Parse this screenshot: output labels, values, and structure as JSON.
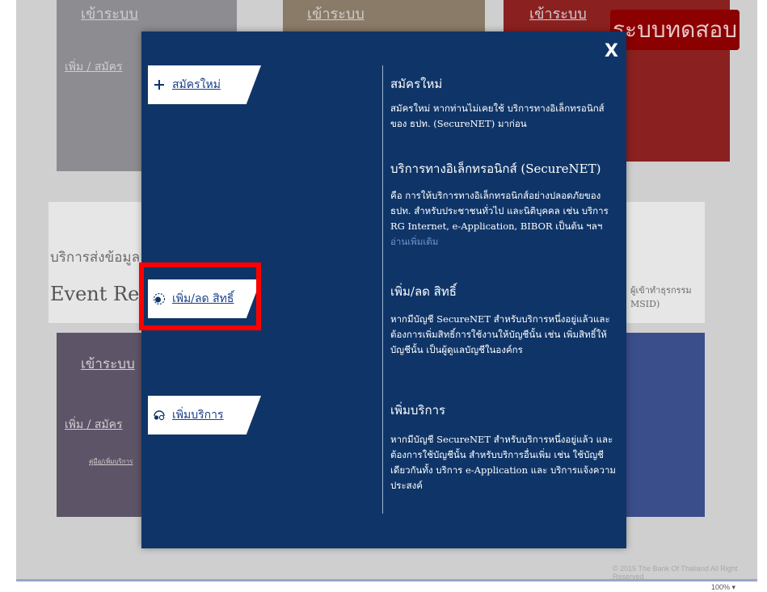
{
  "background": {
    "login_label_1": "เข้าระบบ",
    "login_label_2": "เข้าระบบ",
    "login_label_3": "เข้าระบบ",
    "test_badge": "ระบบทดสอบ",
    "add_apply_1": "เพิ่ม / สมัคร",
    "send_data_text": "บริการส่งข้อมูล",
    "event_text": "Event Re",
    "right_text_1": "ผู้เข้าทำธุรกรรม",
    "right_text_2": "MSID)",
    "login_label_4": "เข้าระบบ",
    "add_apply_2": "เพิ่ม / สมัคร",
    "small_link": "คู่มือ/เพิ่มบริการ",
    "copyright": "© 2015 The Bank Of Thailand All Right Reserved",
    "zoom": "100%"
  },
  "modal": {
    "close_label": "X",
    "options": {
      "register": "สมัครใหม่",
      "add_remove_rights": "เพิ่ม/ลด สิทธิ์",
      "add_service": "เพิ่มบริการ"
    },
    "sections": {
      "register_title": "สมัครใหม่",
      "register_desc": "สมัครใหม่ หากท่านไม่เคยใช้ บริการทางอิเล็กทรอนิกส์ของ ธปท. (SecureNET) มาก่อน",
      "securenet_title": "บริการทางอิเล็กทรอนิกส์ (SecureNET)",
      "securenet_desc": "คือ การให้บริการทางอิเล็กทรอนิกส์อย่างปลอดภัยของ ธปท. สำหรับประชาชนทั่วไป และนิติบุคคล เช่น บริการ RG Internet, e-Application, BIBOR เป็นต้น ฯลฯ",
      "securenet_link": "อ่านเพิ่มเติม",
      "rights_title": "เพิ่ม/ลด สิทธิ์",
      "rights_desc": "หากมีบัญชี SecureNET สำหรับบริการหนึ่งอยู่แล้วและต้องการเพิ่มสิทธิ์การใช้งานให้บัญชีนั้น เช่น เพิ่มสิทธิ์ให้บัญชีนั้น เป็นผู้ดูแลบัญชีในองค์กร",
      "service_title": "เพิ่มบริการ",
      "service_desc": "หากมีบัญชี SecureNET สำหรับบริการหนึ่งอยู่แล้ว และต้องการใช้บัญชีนั้น สำหรับบริการอื่นเพิ่ม เช่น ใช้บัญชีเดียวกันทั้ง บริการ e-Application และ บริการแจ้งความประสงค์"
    }
  }
}
